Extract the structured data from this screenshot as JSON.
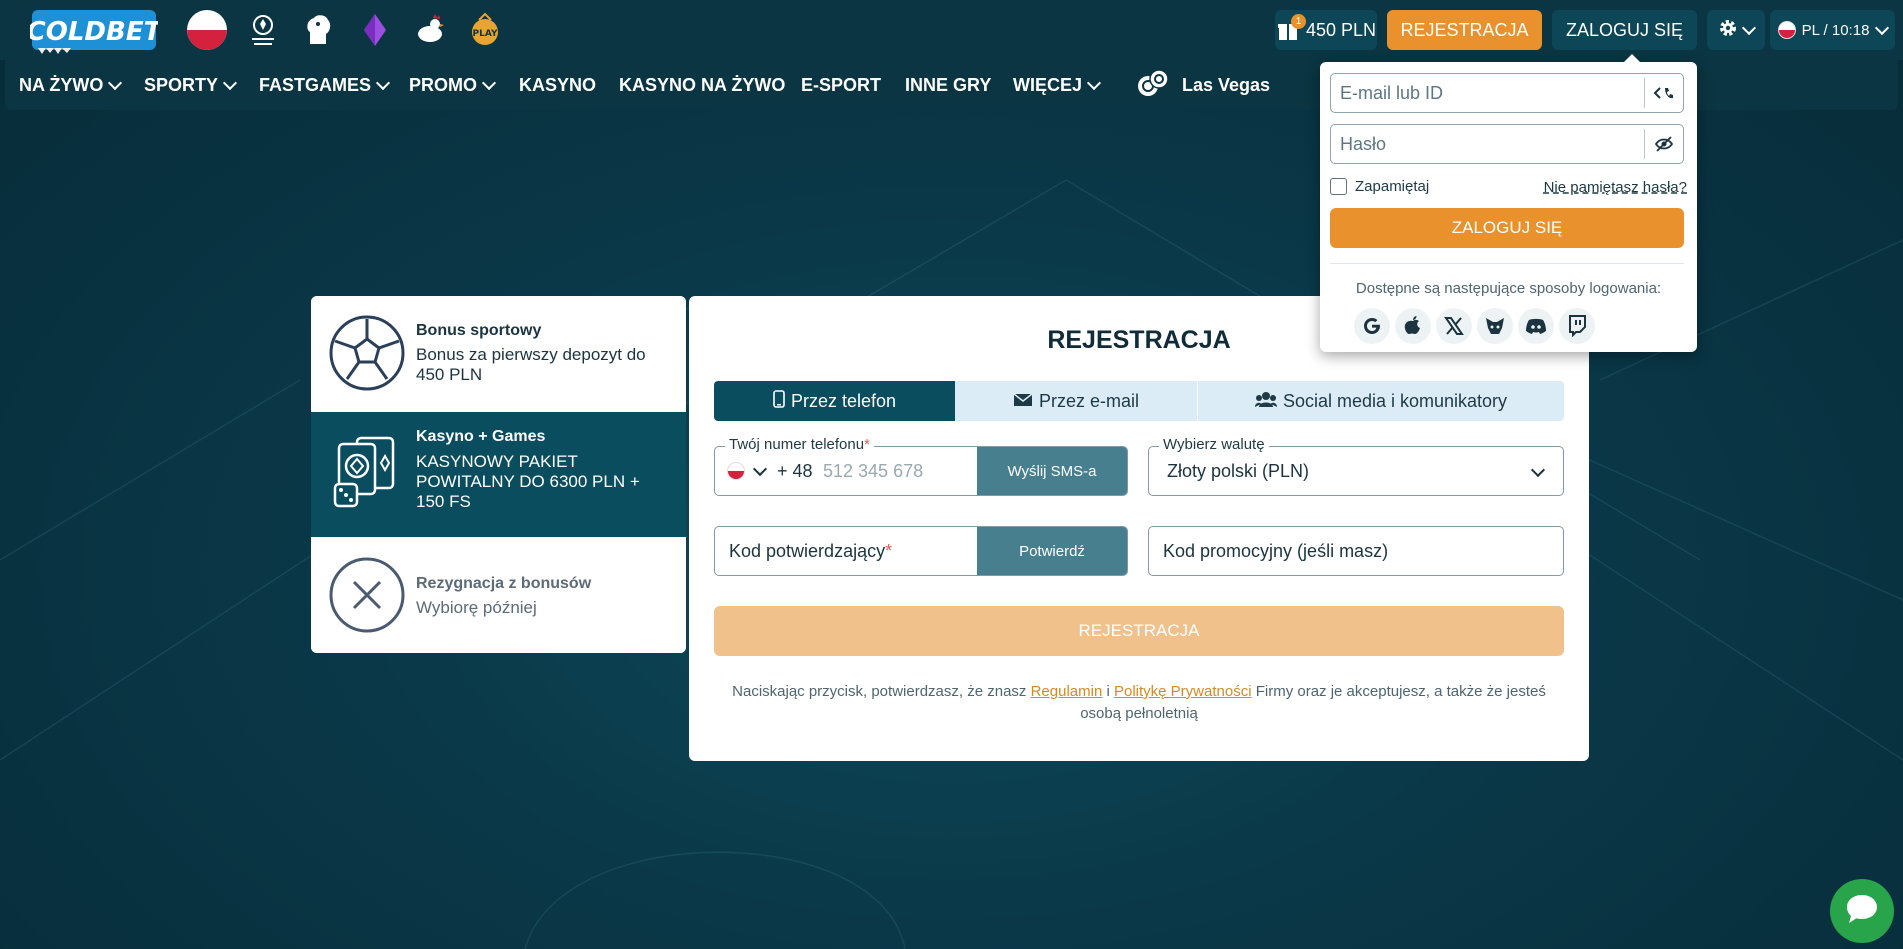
{
  "header": {
    "logo_text": "COLDBET",
    "bonus_balance": "450 PLN",
    "bonus_badge": "1",
    "register_label": "REJESTRACJA",
    "login_label": "ZALOGUJ SIĘ",
    "lang_time": "PL / 10:18",
    "quick_icons": [
      "poland-flag-icon",
      "champions-league-icon",
      "premier-league-icon",
      "crystal-icon",
      "rooster-icon",
      "play-icon"
    ]
  },
  "nav": {
    "items": [
      {
        "label": "NA ŻYWO",
        "dropdown": true
      },
      {
        "label": "SPORTY",
        "dropdown": true
      },
      {
        "label": "FASTGAMES",
        "dropdown": true
      },
      {
        "label": "PROMO",
        "dropdown": true
      },
      {
        "label": "KASYNO",
        "dropdown": false
      },
      {
        "label": "KASYNO NA ŻYWO",
        "dropdown": false
      },
      {
        "label": "E-SPORT",
        "dropdown": false
      },
      {
        "label": "INNE GRY",
        "dropdown": false
      },
      {
        "label": "WIĘCEJ",
        "dropdown": true
      }
    ],
    "las_vegas": "Las Vegas"
  },
  "bonuses": [
    {
      "title": "Bonus sportowy",
      "desc": "Bonus za pierwszy depozyt do 450 PLN",
      "icon": "soccer-ball-icon",
      "selected": false
    },
    {
      "title": "Kasyno + Games",
      "desc": "KASYNOWY PAKIET POWITALNY DO 6300 PLN + 150 FS",
      "icon": "cards-dice-icon",
      "selected": true
    },
    {
      "title": "Rezygnacja z bonusów",
      "desc": "Wybiorę później",
      "icon": "close-circle-icon",
      "selected": false
    }
  ],
  "registration": {
    "title": "REJESTRACJA",
    "tabs": [
      "Przez telefon",
      "Przez e-mail",
      "Social media i komunikatory"
    ],
    "active_tab": 0,
    "phone_label": "Twój numer telefonu",
    "phone_prefix": "+ 48",
    "phone_placeholder": "512 345 678",
    "send_sms": "Wyślij SMS-a",
    "currency_label": "Wybierz walutę",
    "currency_value": "Złoty polski (PLN)",
    "code_label": "Kod potwierdzający",
    "confirm": "Potwierdź",
    "promo_placeholder": "Kod promocyjny (jeśli masz)",
    "submit": "REJESTRACJA",
    "terms_pre": "Naciskając przycisk, potwierdzasz, że znasz",
    "terms_link1": "Regulamin",
    "terms_and": "i",
    "terms_link2": "Politykę Prywatności",
    "terms_post": "Firmy oraz je akceptujesz, a także że jesteś osobą pełnoletnią"
  },
  "login": {
    "email_placeholder": "E-mail lub ID",
    "password_placeholder": "Hasło",
    "remember": "Zapamiętaj",
    "forgot": "Nie pamiętasz hasła?",
    "submit": "ZALOGUJ SIĘ",
    "social_text": "Dostępne są następujące sposoby logowania:",
    "social": [
      "google-icon",
      "apple-icon",
      "x-icon",
      "metamask-icon",
      "discord-icon",
      "twitch-icon"
    ]
  },
  "colors": {
    "accent": "#e8912d",
    "primary": "#0a4d5f",
    "background": "#0a3848"
  }
}
